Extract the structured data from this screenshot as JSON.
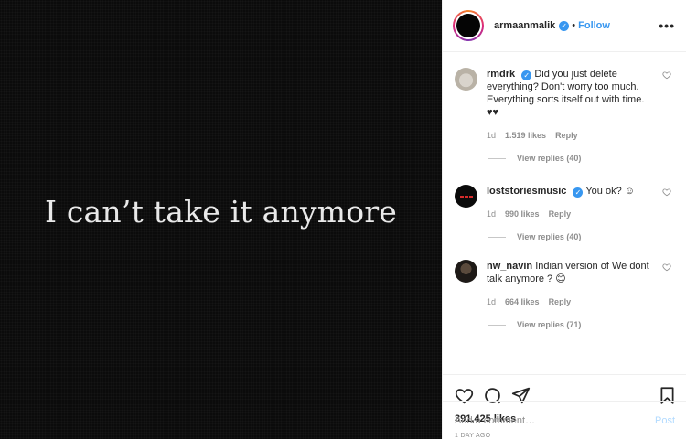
{
  "post": {
    "image_text": "I can’t take it anymore",
    "author": "armaanmalik",
    "separator": "•",
    "follow_label": "Follow",
    "more_label": "•••"
  },
  "comments": [
    {
      "user": "rmdrk",
      "text": "Did you just delete everything? Don't worry too much. Everything sorts itself out with time. ♥♥",
      "verified": true,
      "time": "1d",
      "likes": "1.519 likes",
      "reply": "Reply",
      "view_replies": "View replies (40)"
    },
    {
      "user": "loststoriesmusic",
      "text": "You ok? ☺",
      "verified": true,
      "time": "1d",
      "likes": "990 likes",
      "reply": "Reply",
      "view_replies": "View replies (40)"
    },
    {
      "user": "nw_navin",
      "text": "Indian version of We dont talk anymore ? 😊",
      "verified": false,
      "time": "1d",
      "likes": "664 likes",
      "reply": "Reply",
      "view_replies": "View replies (71)"
    }
  ],
  "actions": {
    "likes_count": "391,425 likes",
    "date": "1 DAY AGO"
  },
  "add_comment": {
    "placeholder": "Add a comment…",
    "post_label": "Post"
  },
  "colors": {
    "accent": "#3897f0",
    "post_disabled": "#b3dbff",
    "muted": "#8e8e8e"
  }
}
